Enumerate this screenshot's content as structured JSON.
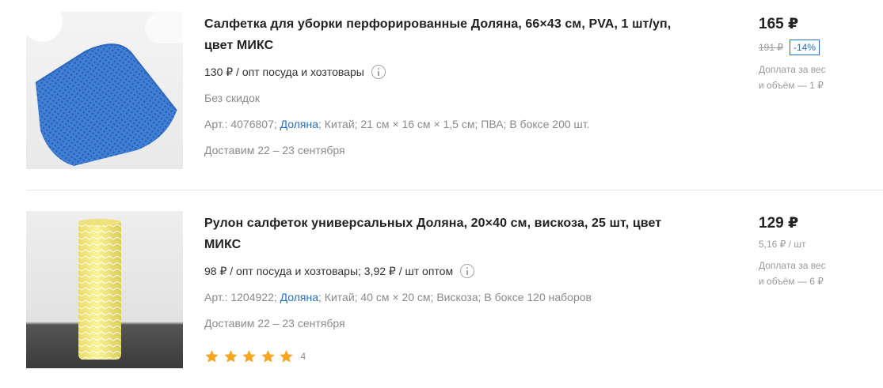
{
  "products": [
    {
      "title": "Салфетка для уборки перфорированные Доляна, 66×43 см, PVA, 1 шт/уп, цвет МИКС",
      "wholesale": "130 ₽ / опт посуда и хозтовары",
      "discount_note": "Без скидок",
      "sku_label": "Арт.: 4076807;",
      "brand": "Доляна",
      "details": "; Китай; 21 см × 16 см × 1,5 см; ПВА; В боксе 200 шт.",
      "delivery": "Доставим 22 – 23 сентября",
      "price": "165 ₽",
      "old_price": "191 ₽",
      "discount": "-14%",
      "surcharge_line1": "Доплата за вес",
      "surcharge_line2": "и объём — 1 ₽",
      "image_icon": "blue-perforated-cloth-image"
    },
    {
      "title": "Рулон салфеток универсальных Доляна, 20×40 см, вискоза, 25 шт, цвет МИКС",
      "wholesale": "98 ₽ / опт посуда и хозтовары; 3,92 ₽ / шт оптом",
      "sku_label": "Арт.: 1204922;",
      "brand": "Доляна",
      "details": "; Китай; 40 см × 20 см; Вискоза; В боксе 120 наборов",
      "delivery": "Доставим 22 – 23 сентября",
      "rating": 5,
      "rating_count": "4",
      "price": "129 ₽",
      "unit_price": "5,16 ₽ / шт",
      "surcharge_line1": "Доплата за вес",
      "surcharge_line2": "и объём — 6 ₽",
      "image_icon": "yellow-wipes-roll-image"
    }
  ],
  "colors": {
    "link": "#2a6fba",
    "star": "#f5a623",
    "muted": "#8a8a8a"
  }
}
